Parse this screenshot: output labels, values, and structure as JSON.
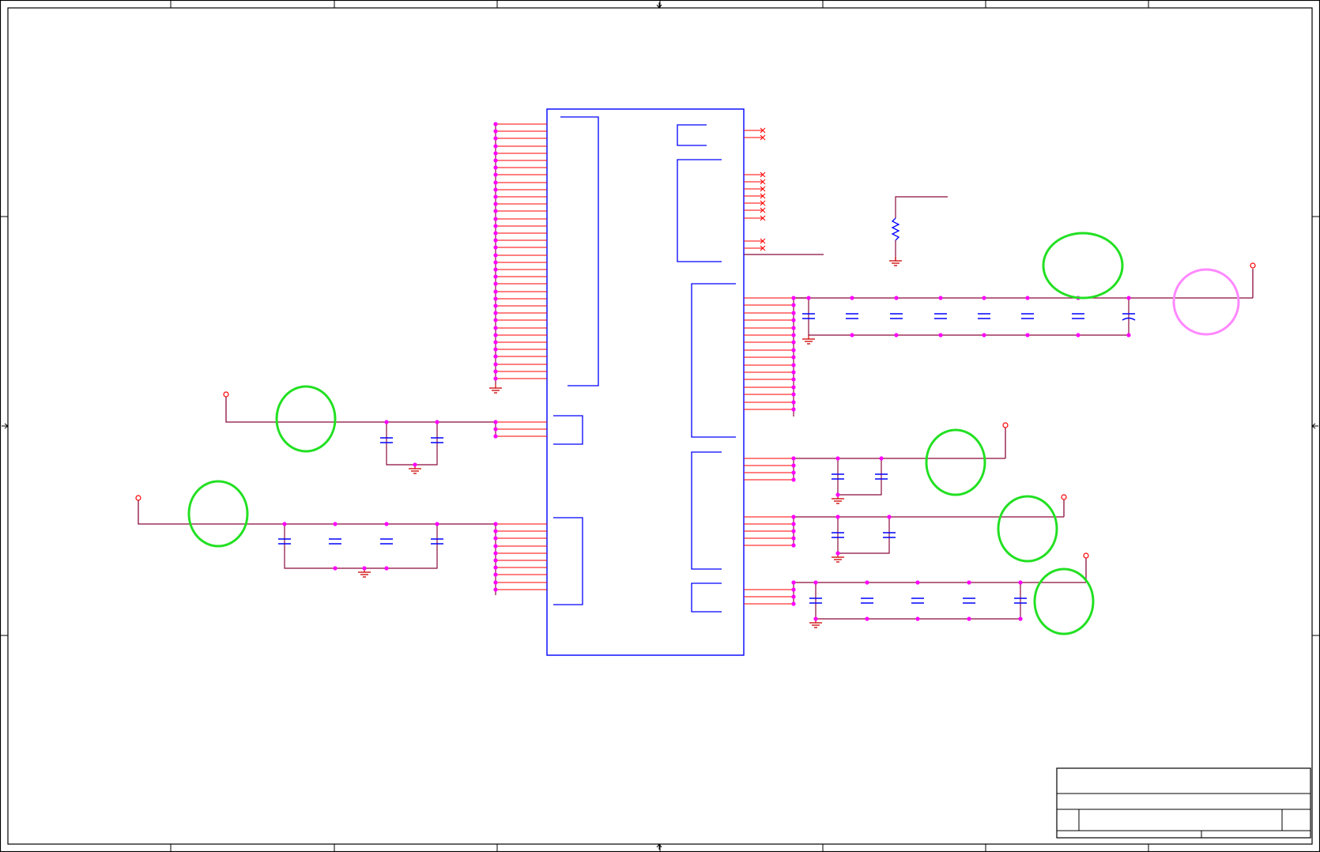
{
  "schematic": {
    "colors": {
      "frame": "#000000",
      "wire": "#8b0a3c",
      "pin": "#ff0000",
      "junction": "#ff00ff",
      "component": "#0000ff",
      "ground": "#cc0000",
      "highlight": "#22e022",
      "highlight_alt": "#ff88ff"
    },
    "regions": [
      {
        "name": "vdd-rail-left-upper",
        "highlight": "green"
      },
      {
        "name": "vdd-rail-left-lower",
        "highlight": "green"
      },
      {
        "name": "vdd-rail-right-top",
        "highlight": "green"
      },
      {
        "name": "vdd-rail-right-top-connector",
        "highlight": "pink"
      },
      {
        "name": "vdd-rail-right-mid-1",
        "highlight": "green"
      },
      {
        "name": "vdd-rail-right-mid-2",
        "highlight": "green"
      },
      {
        "name": "vdd-rail-right-bottom",
        "highlight": "green"
      }
    ],
    "title_block": {}
  }
}
